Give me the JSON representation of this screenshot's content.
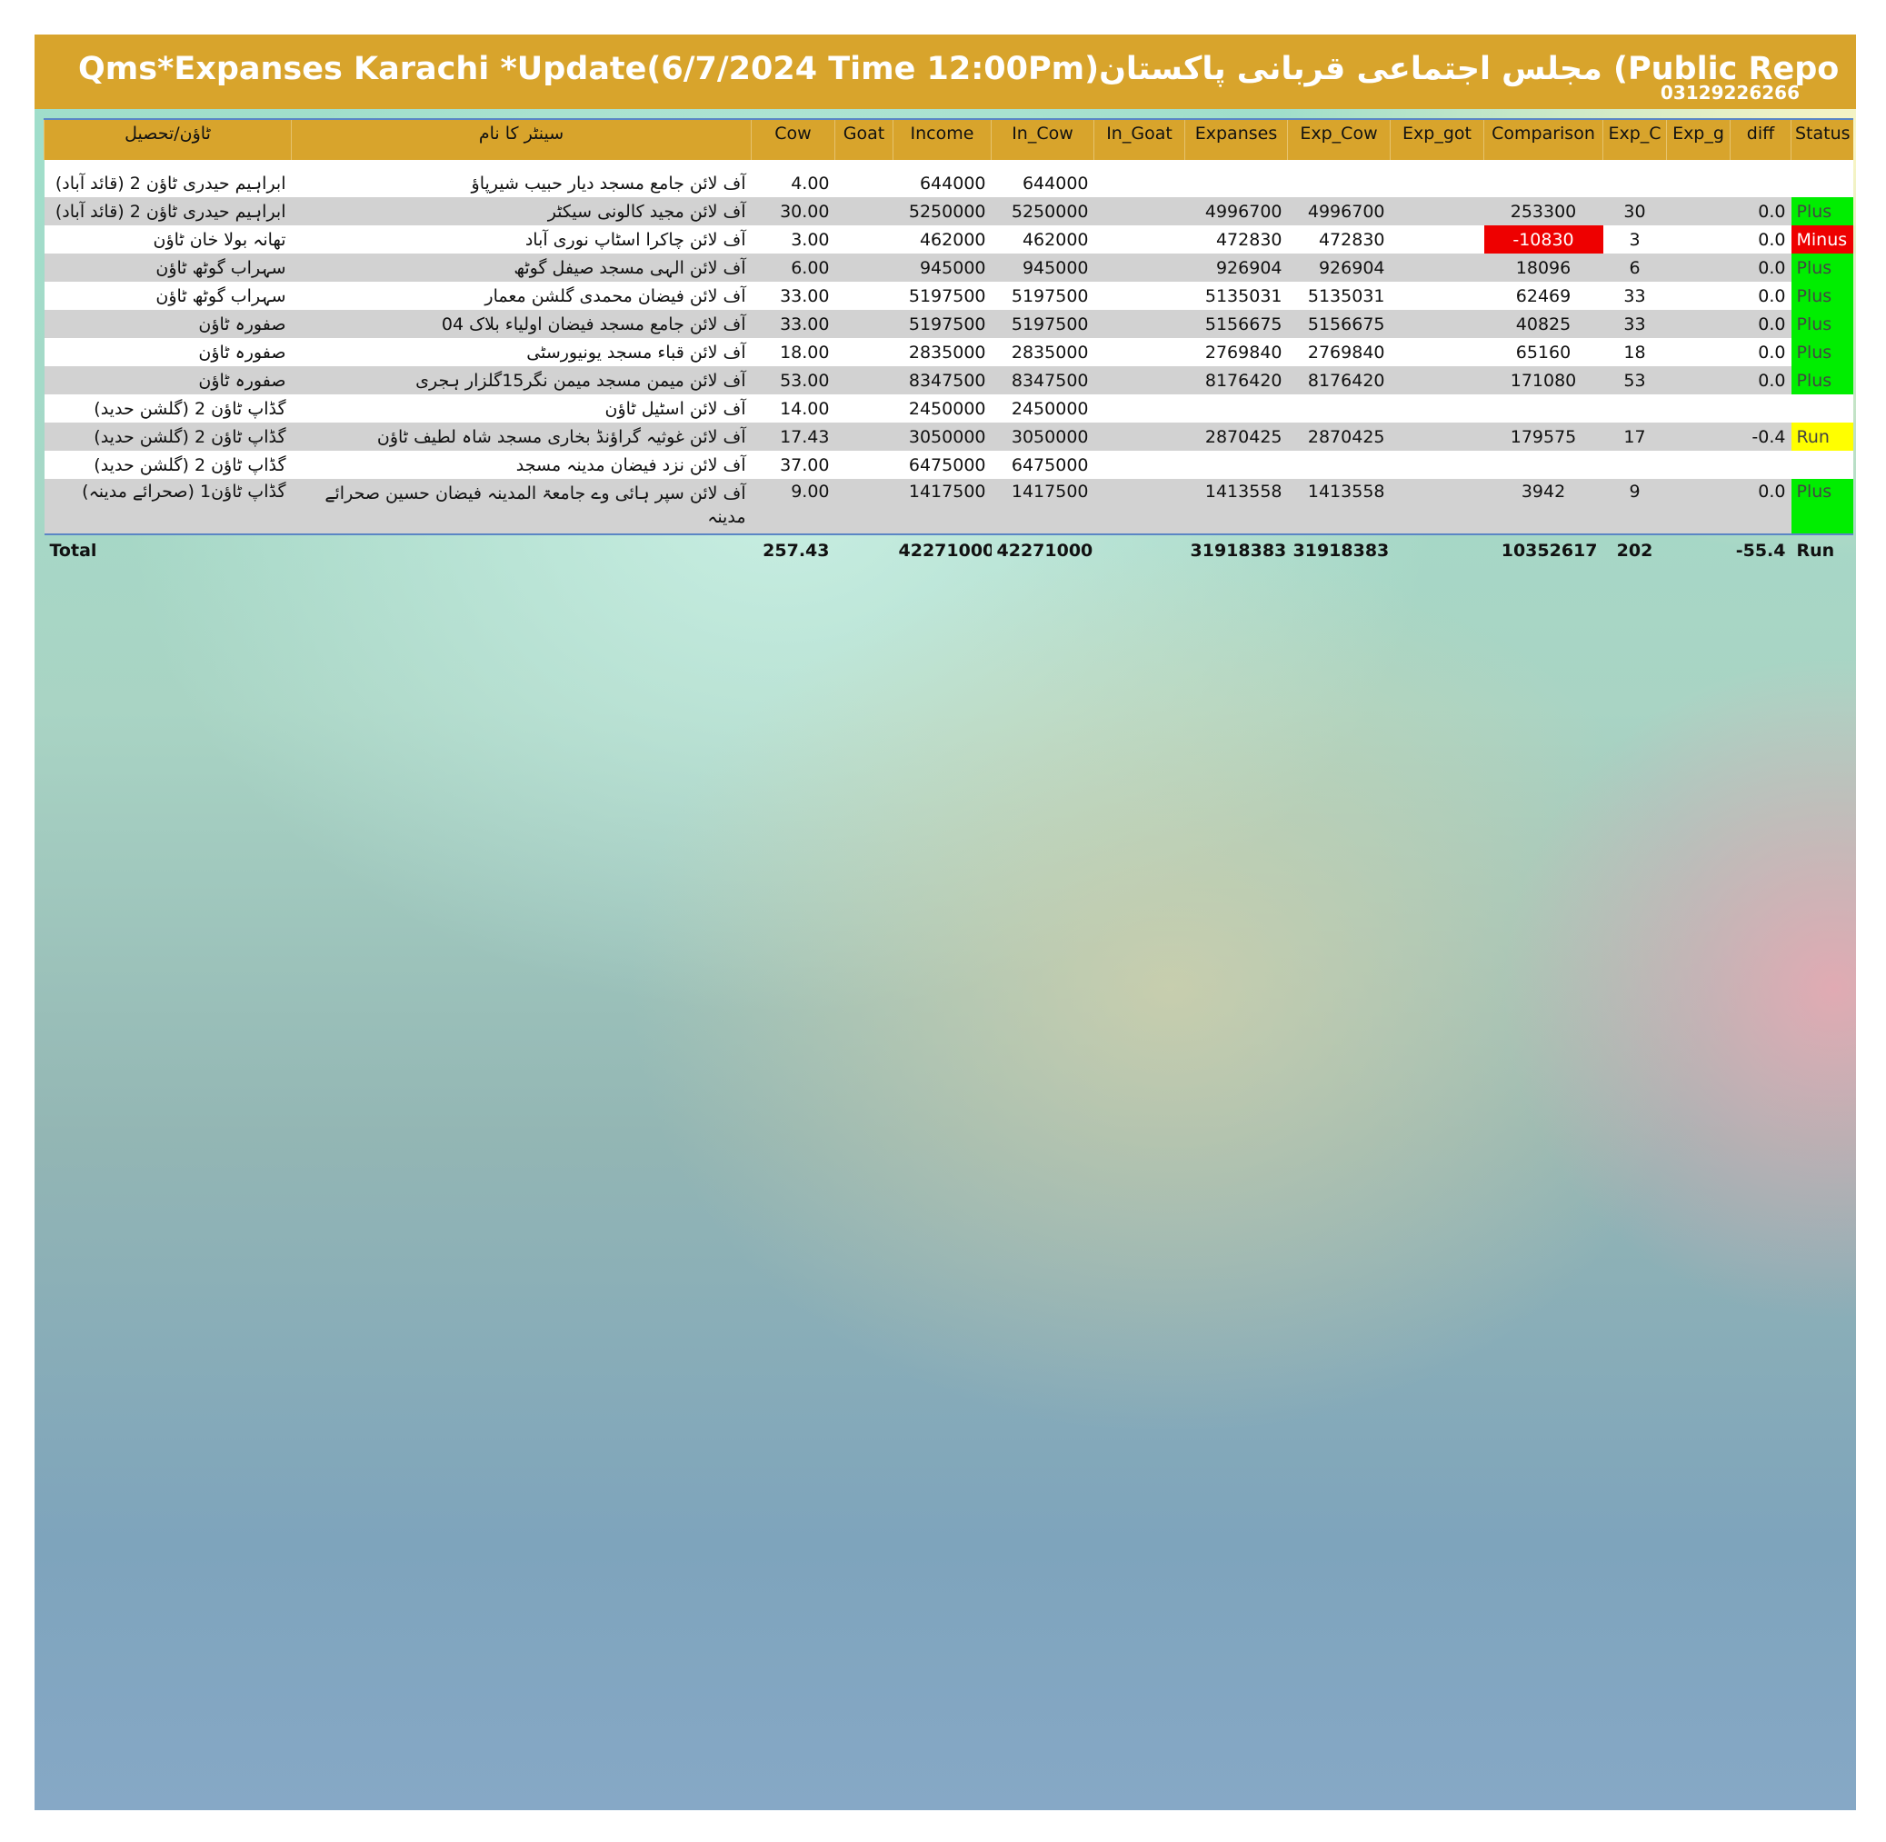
{
  "header": {
    "title": "Qms*Expanses Karachi  *Update(6/7/2024 Time 12:00Pm)مجلس اجتماعی قربانی پاکستان (Public Reports)*Mubeen Attari",
    "phone": "03129226266"
  },
  "table": {
    "columns": [
      "ٹاؤن/تحصیل",
      "سینٹر کا نام",
      "Cow",
      "Goat",
      "Income",
      "In_Cow",
      "In_Goat",
      "Expanses",
      "Exp_Cow",
      "Exp_got",
      "Comparison",
      "Exp_C",
      "Exp_g",
      "diff",
      "Status"
    ],
    "rows": [
      {
        "town": "ابراہیم حیدری ٹاؤن 2 (قائد آباد)",
        "center": "آف لائن جامع مسجد دیار حبیب شیرپاؤ",
        "cow": "4.00",
        "goat": "",
        "income": "644000",
        "in_cow": "644000",
        "in_goat": "",
        "expanses": "",
        "exp_cow": "",
        "exp_got": "",
        "comparison": "",
        "exp_c": "",
        "exp_g": "",
        "diff": "",
        "status": ""
      },
      {
        "town": "ابراہیم حیدری ٹاؤن 2 (قائد آباد)",
        "center": "آف لائن مجید کالونی سیکٹر",
        "cow": "30.00",
        "goat": "",
        "income": "5250000",
        "in_cow": "5250000",
        "in_goat": "",
        "expanses": "4996700",
        "exp_cow": "4996700",
        "exp_got": "",
        "comparison": "253300",
        "exp_c": "30",
        "exp_g": "",
        "diff": "0.0",
        "status": "Plus"
      },
      {
        "town": "تھانہ بولا خان ٹاؤن",
        "center": "آف لائن چاکرا اسٹاپ نوری آباد",
        "cow": "3.00",
        "goat": "",
        "income": "462000",
        "in_cow": "462000",
        "in_goat": "",
        "expanses": "472830",
        "exp_cow": "472830",
        "exp_got": "",
        "comparison": "-10830",
        "exp_c": "3",
        "exp_g": "",
        "diff": "0.0",
        "status": "Minus"
      },
      {
        "town": "سہراب گوٹھ ٹاؤن",
        "center": "آف لائن الہی مسجد صیفل گوٹھ",
        "cow": "6.00",
        "goat": "",
        "income": "945000",
        "in_cow": "945000",
        "in_goat": "",
        "expanses": "926904",
        "exp_cow": "926904",
        "exp_got": "",
        "comparison": "18096",
        "exp_c": "6",
        "exp_g": "",
        "diff": "0.0",
        "status": "Plus"
      },
      {
        "town": "سہراب گوٹھ ٹاؤن",
        "center": "آف لائن فیضان محمدی گلشن معمار",
        "cow": "33.00",
        "goat": "",
        "income": "5197500",
        "in_cow": "5197500",
        "in_goat": "",
        "expanses": "5135031",
        "exp_cow": "5135031",
        "exp_got": "",
        "comparison": "62469",
        "exp_c": "33",
        "exp_g": "",
        "diff": "0.0",
        "status": "Plus"
      },
      {
        "town": "صفورہ ٹاؤن",
        "center": "آف لائن جامع مسجد فیضان اولیاء بلاک 04",
        "cow": "33.00",
        "goat": "",
        "income": "5197500",
        "in_cow": "5197500",
        "in_goat": "",
        "expanses": "5156675",
        "exp_cow": "5156675",
        "exp_got": "",
        "comparison": "40825",
        "exp_c": "33",
        "exp_g": "",
        "diff": "0.0",
        "status": "Plus"
      },
      {
        "town": "صفورہ ٹاؤن",
        "center": "آف لائن قباء مسجد یونیورسٹی",
        "cow": "18.00",
        "goat": "",
        "income": "2835000",
        "in_cow": "2835000",
        "in_goat": "",
        "expanses": "2769840",
        "exp_cow": "2769840",
        "exp_got": "",
        "comparison": "65160",
        "exp_c": "18",
        "exp_g": "",
        "diff": "0.0",
        "status": "Plus"
      },
      {
        "town": "صفورہ ٹاؤن",
        "center": "آف لائن میمن مسجد میمن نگر15گلزار ہجری",
        "cow": "53.00",
        "goat": "",
        "income": "8347500",
        "in_cow": "8347500",
        "in_goat": "",
        "expanses": "8176420",
        "exp_cow": "8176420",
        "exp_got": "",
        "comparison": "171080",
        "exp_c": "53",
        "exp_g": "",
        "diff": "0.0",
        "status": "Plus"
      },
      {
        "town": "گڈاپ ٹاؤن 2 (گلشن حدید)",
        "center": "آف لائن اسٹیل ٹاؤن",
        "cow": "14.00",
        "goat": "",
        "income": "2450000",
        "in_cow": "2450000",
        "in_goat": "",
        "expanses": "",
        "exp_cow": "",
        "exp_got": "",
        "comparison": "",
        "exp_c": "",
        "exp_g": "",
        "diff": "",
        "status": ""
      },
      {
        "town": "گڈاپ ٹاؤن 2 (گلشن حدید)",
        "center": "آف لائن غوثیہ گراؤنڈ بخاری مسجد شاہ لطیف ٹاؤن",
        "cow": "17.43",
        "goat": "",
        "income": "3050000",
        "in_cow": "3050000",
        "in_goat": "",
        "expanses": "2870425",
        "exp_cow": "2870425",
        "exp_got": "",
        "comparison": "179575",
        "exp_c": "17",
        "exp_g": "",
        "diff": "-0.4",
        "status": "Run"
      },
      {
        "town": "گڈاپ ٹاؤن 2 (گلشن حدید)",
        "center": "آف لائن نزد فیضان مدینہ مسجد",
        "cow": "37.00",
        "goat": "",
        "income": "6475000",
        "in_cow": "6475000",
        "in_goat": "",
        "expanses": "",
        "exp_cow": "",
        "exp_got": "",
        "comparison": "",
        "exp_c": "",
        "exp_g": "",
        "diff": "",
        "status": ""
      },
      {
        "town": "گڈاپ ٹاؤن1 (صحرائے مدینہ)",
        "center": "آف لائن سپر ہائی وے جامعۃ المدینہ فیضان حسین صحرائے مدینہ",
        "cow": "9.00",
        "goat": "",
        "income": "1417500",
        "in_cow": "1417500",
        "in_goat": "",
        "expanses": "1413558",
        "exp_cow": "1413558",
        "exp_got": "",
        "comparison": "3942",
        "exp_c": "9",
        "exp_g": "",
        "diff": "0.0",
        "status": "Plus"
      }
    ],
    "total": {
      "label": "Total",
      "cow": "257.43",
      "income": "42271000",
      "in_cow": "42271000",
      "expanses": "31918383",
      "exp_cow": "31918383",
      "comparison": "10352617",
      "exp_c": "202",
      "diff": "-55.4",
      "status": "Run"
    }
  },
  "colors": {
    "header_bar": "#d8a42c",
    "status_plus": "#00ee00",
    "status_minus": "#ee0000",
    "status_run": "#ffff00",
    "alt_row": "#d2d2d2"
  }
}
